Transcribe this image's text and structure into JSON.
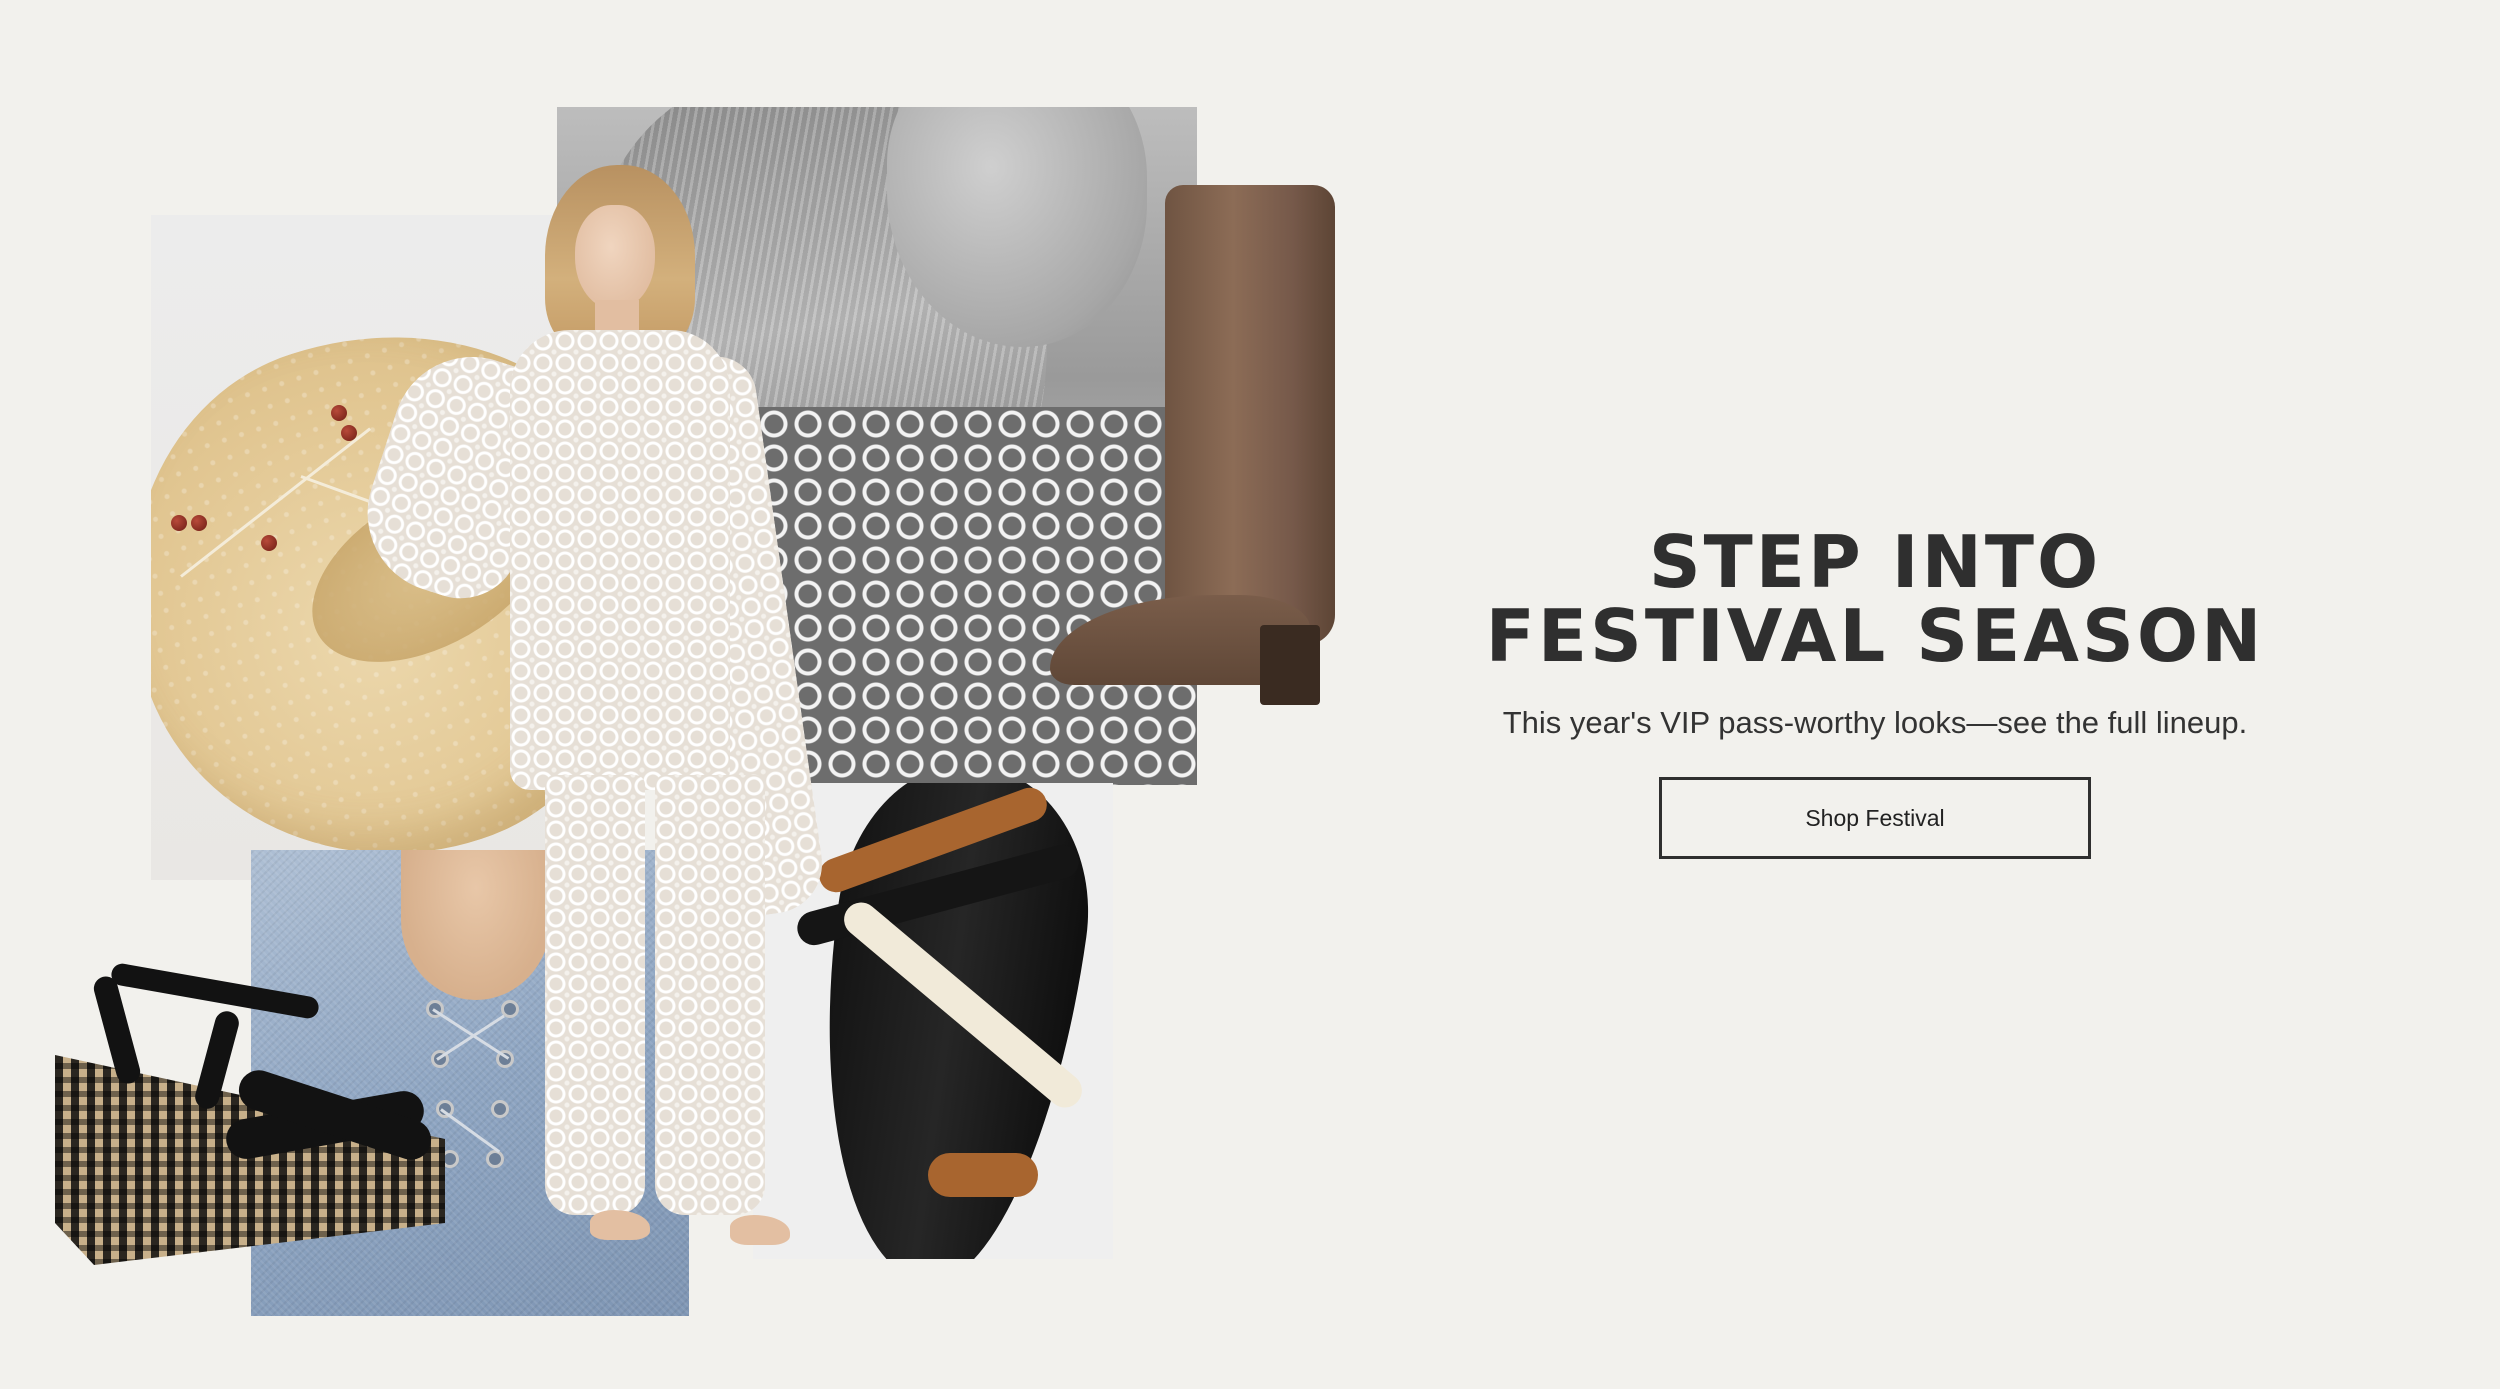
{
  "hero": {
    "headline_line1": "STEP INTO",
    "headline_line2": "FESTIVAL SEASON",
    "subheadline": "This year's VIP pass-worthy looks—see the full lineup.",
    "cta_label": "Shop Festival"
  },
  "colors": {
    "background": "#f2f1ed",
    "text": "#2f2f2f",
    "button_border": "#2f2f2f"
  }
}
